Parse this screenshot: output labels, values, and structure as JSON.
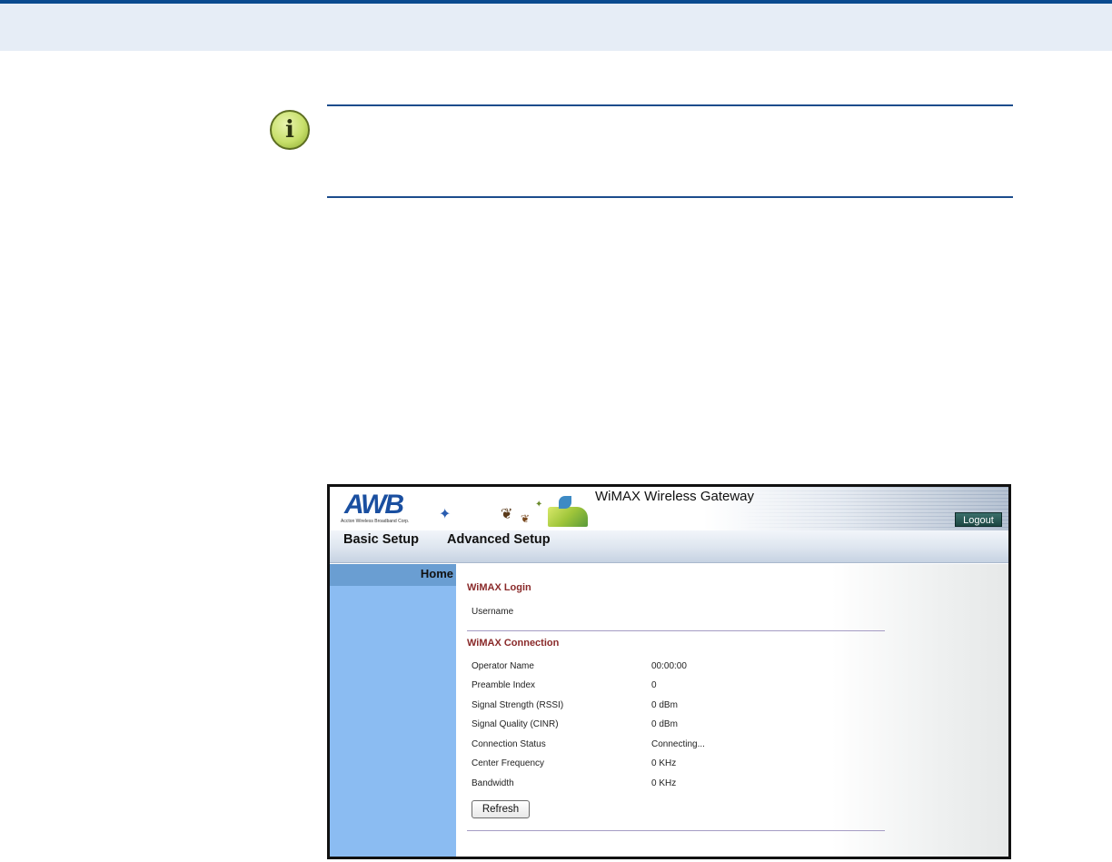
{
  "note": {
    "icon": "info-icon"
  },
  "app": {
    "title": "WiMAX Wireless Gateway",
    "logo_text": "AWB",
    "logo_subtext": "Accton Wireless Broadband Corp.",
    "logout_label": "Logout"
  },
  "menu": {
    "basic_setup": "Basic Setup",
    "advanced_setup": "Advanced Setup"
  },
  "sidebar": {
    "home": "Home"
  },
  "login": {
    "title": "WiMAX Login",
    "rows": [
      {
        "label": "Username",
        "value": ""
      }
    ]
  },
  "connection": {
    "title": "WiMAX Connection",
    "rows": [
      {
        "label": "Operator Name",
        "value": "00:00:00"
      },
      {
        "label": "Preamble Index",
        "value": "0"
      },
      {
        "label": "Signal Strength (RSSI)",
        "value": "0 dBm"
      },
      {
        "label": "Signal Quality (CINR)",
        "value": "0 dBm"
      },
      {
        "label": "Connection Status",
        "value": "Connecting..."
      },
      {
        "label": "Center Frequency",
        "value": "0 KHz"
      },
      {
        "label": "Bandwidth",
        "value": "0 KHz"
      }
    ],
    "refresh_label": "Refresh"
  },
  "colors": {
    "header_band": "#e6edf6",
    "header_rule": "#0a4a8f",
    "sidebar": "#8bbcf2",
    "sidebar_active": "#6a9ed2",
    "section_title": "#8a2a2a"
  }
}
